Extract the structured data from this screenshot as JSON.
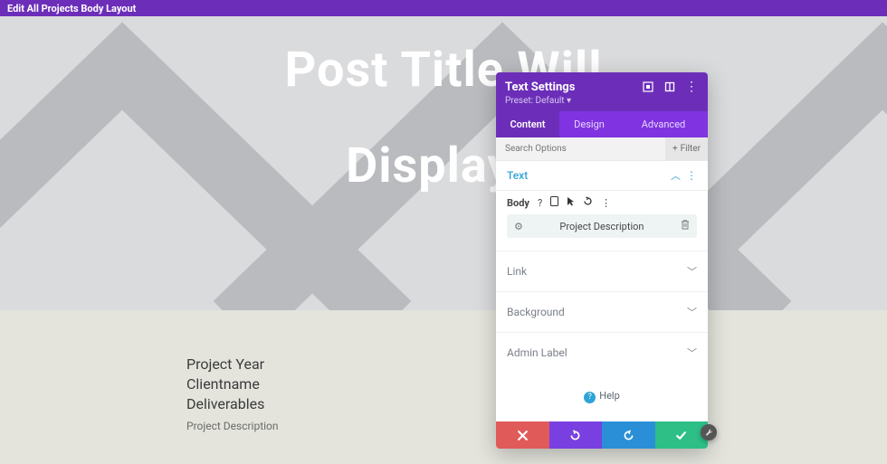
{
  "topbar": {
    "title": "Edit All Projects Body Layout"
  },
  "hero": {
    "line1": "Post Title Will",
    "line2": "Display I"
  },
  "meta": {
    "line1": "Project Year",
    "line2": "Clientname",
    "line3": "Deliverables",
    "desc": "Project Description"
  },
  "panel": {
    "title": "Text Settings",
    "preset": "Preset: Default ▾",
    "tabs": {
      "content": "Content",
      "design": "Design",
      "advanced": "Advanced"
    },
    "search_placeholder": "Search Options",
    "filter_label": "Filter",
    "sections": {
      "text": "Text",
      "link": "Link",
      "background": "Background",
      "admin_label": "Admin Label"
    },
    "text_section": {
      "body_label": "Body",
      "content_value": "Project Description"
    },
    "help": "Help"
  }
}
